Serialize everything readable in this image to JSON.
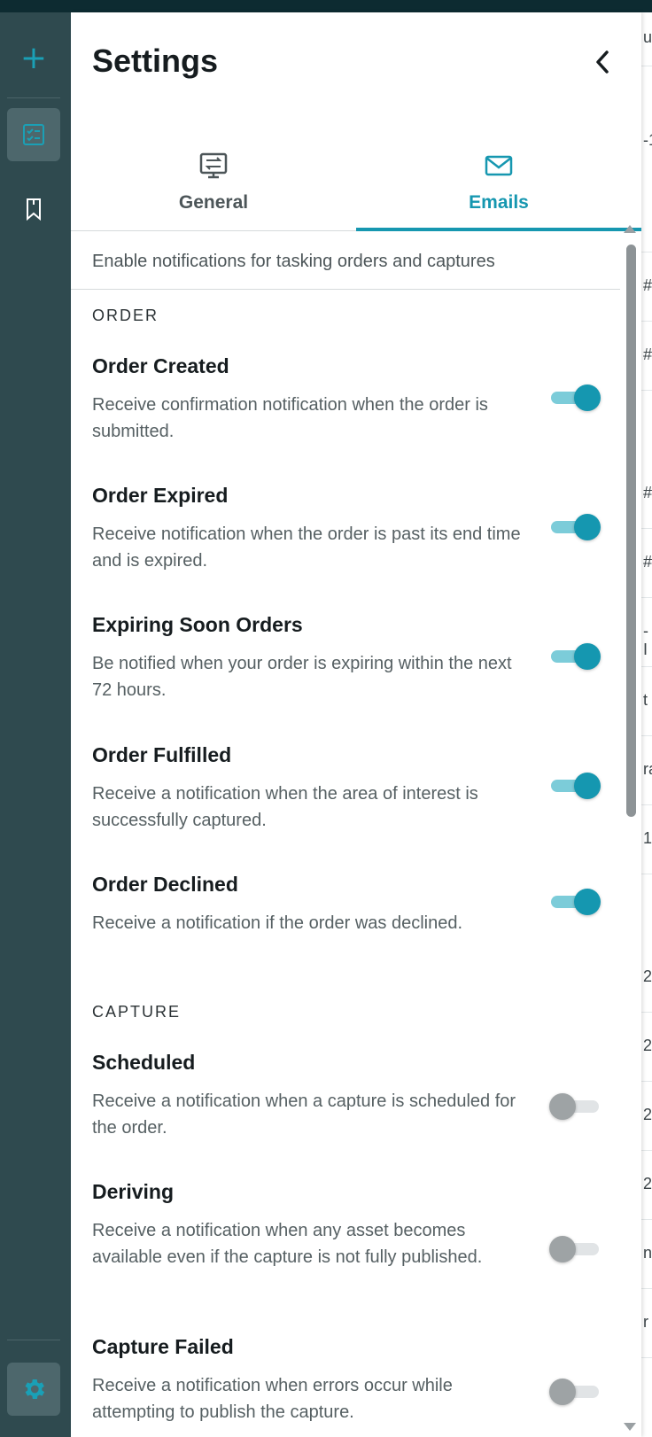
{
  "panel": {
    "title": "Settings"
  },
  "tabs": [
    {
      "label": "General",
      "icon": "monitor-transfer-icon",
      "active": false
    },
    {
      "label": "Emails",
      "icon": "mail-icon",
      "active": true
    }
  ],
  "intro": "Enable notifications for tasking orders and captures",
  "sections": [
    {
      "heading": "ORDER",
      "items": [
        {
          "title": "Order Created",
          "desc": "Receive confirmation notification when the order is submitted.",
          "enabled": true
        },
        {
          "title": "Order Expired",
          "desc": "Receive notification when the order is past its end time and is expired.",
          "enabled": true
        },
        {
          "title": "Expiring Soon Orders",
          "desc": "Be notified when your order is expiring within the next 72 hours.",
          "enabled": true
        },
        {
          "title": "Order Fulfilled",
          "desc": "Receive a notification when the area of interest is successfully captured.",
          "enabled": true
        },
        {
          "title": "Order Declined",
          "desc": "Receive a notification if the order was declined.",
          "enabled": true
        }
      ]
    },
    {
      "heading": "CAPTURE",
      "items": [
        {
          "title": "Scheduled",
          "desc": "Receive a notification when a capture is scheduled for the order.",
          "enabled": false
        },
        {
          "title": "Deriving",
          "desc": "Receive a notification when any asset becomes available even if the capture is not fully published.",
          "enabled": false
        },
        {
          "title": "Capture Failed",
          "desc": "Receive a notification when errors occur while attempting to publish the capture.",
          "enabled": false
        }
      ]
    }
  ],
  "rail": {
    "items": [
      "plus-icon",
      "tasking-orders-icon",
      "bookmark-icon",
      "settings-gear-icon"
    ]
  },
  "background_peek": [
    "u",
    "-1",
    "#",
    "#",
    "#",
    "#",
    "-I",
    "t",
    "ra",
    "1",
    "2",
    "2",
    "2",
    "2",
    "ni",
    "r"
  ],
  "colors": {
    "accent": "#1697b0",
    "rail": "#2f4a4f",
    "toggle_on": "#1597b0",
    "toggle_off": "#9ea3a5"
  }
}
